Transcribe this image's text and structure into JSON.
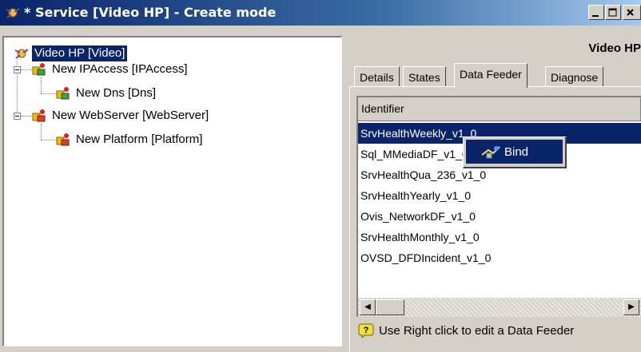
{
  "window": {
    "title": "* Service [Video HP] - Create mode",
    "minimize_label": "_",
    "maximize_label": "□",
    "close_label": "×"
  },
  "tree": {
    "nodes": [
      {
        "label": "Video HP [Video]",
        "icon": "service-icon",
        "selected": true
      },
      {
        "label": "New IPAccess [IPAccess]",
        "icon": "component-icon"
      },
      {
        "label": "New Dns [Dns]",
        "icon": "component-icon"
      },
      {
        "label": "New WebServer [WebServer]",
        "icon": "component-icon"
      },
      {
        "label": "New Platform [Platform]",
        "icon": "component-icon"
      }
    ]
  },
  "panel": {
    "header": "Video HP",
    "tabs": [
      {
        "label": "Details"
      },
      {
        "label": "States"
      },
      {
        "label": "Data Feeder",
        "active": true
      },
      {
        "label": "Diagnose"
      }
    ],
    "list": {
      "column_header": "Identifier",
      "rows": [
        "SrvHealthWeekly_v1_0",
        "Sql_MMediaDF_v1_0",
        "SrvHealthQua_236_v1_0",
        "SrvHealthYearly_v1_0",
        "Ovis_NetworkDF_v1_0",
        "SrvHealthMonthly_v1_0",
        "OVSD_DFDIncident_v1_0"
      ],
      "selected_index": 0
    },
    "context_menu": {
      "items": [
        {
          "label": "Bind",
          "icon": "bind-icon"
        }
      ]
    },
    "hint": "Use Right click to edit a Data Feeder"
  },
  "colors": {
    "selection": "#0a246a",
    "title_gradient_start": "#0a246a",
    "face": "#d4d0c8"
  }
}
